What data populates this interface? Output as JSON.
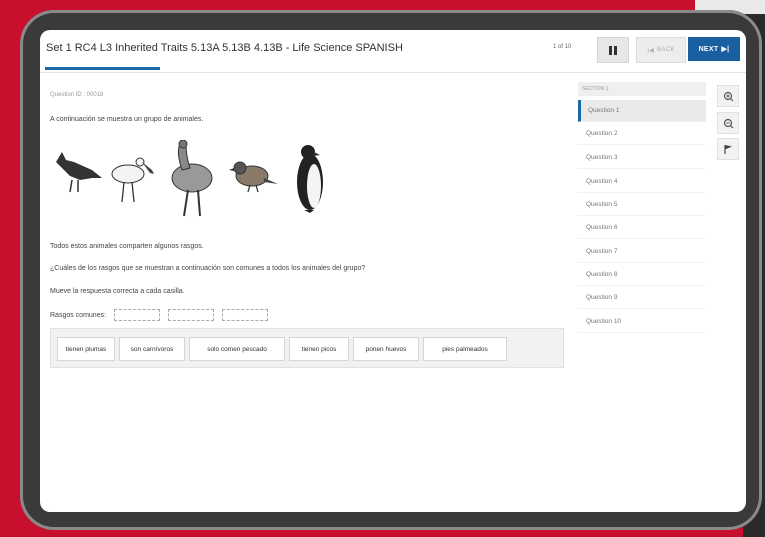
{
  "header": {
    "title": "Set 1 RC4 L3 Inherited Traits 5.13A 5.13B 4.13B - Life Science SPANISH",
    "counter": "1 of 10",
    "back_label": "BACK",
    "next_label": "NEXT"
  },
  "question": {
    "number_label": "Question ID : 00018",
    "intro": "A continuación se muestra un grupo de animales.",
    "statement": "Todos estos animales comparten algunos rasgos.",
    "prompt": "¿Cuáles de los rasgos que se muestran a continuación son comunes a todos los animales del grupo?",
    "instruction": "Mueve la respuesta correcta a cada casilla.",
    "drop_label": "Rasgos comunes:",
    "answers": [
      "tienen plumas",
      "son carnívoros",
      "solo comen pescado",
      "tienen picos",
      "ponen huevos",
      "pies palmeados"
    ]
  },
  "sidebar": {
    "section_label": "SECTION 1",
    "items": [
      "Question 1",
      "Question 2",
      "Question 3",
      "Question 4",
      "Question 5",
      "Question 6",
      "Question 7",
      "Question 8",
      "Question 9",
      "Question 10"
    ]
  },
  "tools": [
    "zoom-in-icon",
    "zoom-out-icon",
    "flag-icon"
  ],
  "colors": {
    "brand_red": "#c8102e",
    "accent_blue": "#1a5fa0"
  }
}
